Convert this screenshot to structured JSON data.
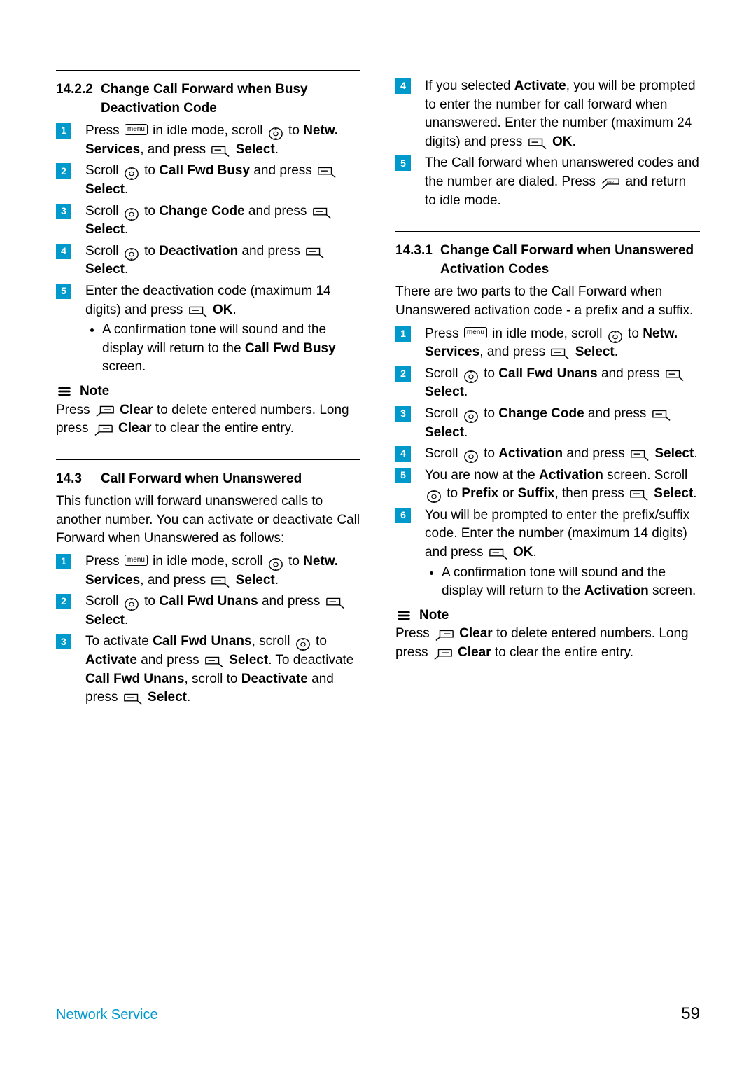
{
  "footer": {
    "section": "Network Service",
    "page": "59"
  },
  "icons": {
    "menu_label": "menu",
    "end_label": "END"
  },
  "left": {
    "sec1422": {
      "num": "14.2.2",
      "title": "Change Call Forward when Busy Deactivation Code",
      "steps": [
        {
          "pre": "Press ",
          "mid": " in idle mode, scroll ",
          "post": " to ",
          "b1": "Netw. Services",
          "mid2": ", and press ",
          "b2": "Select",
          "end": "."
        },
        {
          "pre": "Scroll ",
          "mid": " to ",
          "b1": "Call Fwd Busy",
          "mid2": " and press ",
          "b2": "Select",
          "end": "."
        },
        {
          "pre": "Scroll ",
          "mid": " to ",
          "b1": "Change Code",
          "mid2": " and press ",
          "b2": "Select",
          "end": "."
        },
        {
          "pre": "Scroll ",
          "mid": " to ",
          "b1": "Deactivation",
          "mid2": " and press ",
          "b2": "Select",
          "end": "."
        },
        {
          "plain1": "Enter the deactivation code (maximum 14 digits) and press ",
          "b1": "OK",
          "end": ".",
          "bullet": {
            "t1": "A confirmation tone will sound and the display will return to the ",
            "b": "Call Fwd Busy",
            "t2": " screen."
          }
        }
      ],
      "note_label": "Note",
      "note": {
        "t1": "Press ",
        "b1": "Clear",
        "t2": " to delete entered numbers. Long press ",
        "b2": "Clear",
        "t3": " to clear the entire entry."
      }
    },
    "sec143": {
      "num": "14.3",
      "title": "Call Forward when Unanswered",
      "intro": "This function will forward unanswered calls to another number. You can activate or deactivate Call Forward when Unanswered as follows:",
      "steps": [
        {
          "pre": "Press ",
          "mid": " in idle mode, scroll ",
          "post": " to ",
          "b1": "Netw. Services",
          "mid2": ", and press ",
          "b2": "Select",
          "end": "."
        },
        {
          "pre": "Scroll ",
          "mid": " to ",
          "b1": "Call Fwd Unans",
          "mid2": " and press ",
          "b2": "Select",
          "end": "."
        },
        {
          "s3": {
            "t1": "To activate ",
            "b1": "Call Fwd Unans",
            "t2": ", scroll ",
            "t3": " to ",
            "b2": "Activate",
            "t4": " and press ",
            "b3": "Select",
            "t5": ". To deactivate ",
            "b4": "Call Fwd Unans",
            "t6": ", scroll to ",
            "b5": "Deactivate",
            "t7": " and press ",
            "b6": "Select",
            "end": "."
          }
        }
      ]
    }
  },
  "right": {
    "cont": {
      "step4": {
        "t1": "If you selected ",
        "b1": "Activate",
        "t2": ", you will be prompted to enter the number for call forward when unanswered. Enter the number (maximum 24 digits) and press ",
        "b2": "OK",
        "end": "."
      },
      "step5": {
        "t1": "The Call forward when unanswered codes and the number are dialed. Press ",
        "t2": " and return to idle mode."
      }
    },
    "sec1431": {
      "num": "14.3.1",
      "title": "Change Call Forward when Unanswered Activation Codes",
      "intro": "There are two parts to the Call Forward when Unanswered activation code - a prefix and a suffix.",
      "steps": [
        {
          "pre": "Press ",
          "mid": " in idle mode, scroll ",
          "post": " to ",
          "b1": "Netw. Services",
          "mid2": ", and press ",
          "b2": "Select",
          "end": "."
        },
        {
          "pre": "Scroll ",
          "mid": " to ",
          "b1": "Call Fwd Unans",
          "mid2": " and press ",
          "b2": "Select",
          "end": "."
        },
        {
          "pre": "Scroll ",
          "mid": " to ",
          "b1": "Change Code",
          "mid2": " and press ",
          "b2": "Select",
          "end": "."
        },
        {
          "pre": "Scroll ",
          "mid": " to ",
          "b1": "Activation",
          "mid2": " and press ",
          "b2": "Select",
          "end": "."
        },
        {
          "s5": {
            "t1": "You are now at the ",
            "b1": "Activation",
            "t2": " screen. Scroll ",
            "t3": " to ",
            "b2": "Prefix",
            "t4": " or ",
            "b3": "Suffix",
            "t5": ", then press ",
            "b4": "Select",
            "end": "."
          }
        },
        {
          "s6": {
            "t1": "You will be prompted to enter the prefix/suffix code. Enter the number (maximum 14 digits) and press ",
            "b1": "OK",
            "end": ".",
            "bullet": {
              "t1": "A confirmation tone will sound and the display will return to the ",
              "b": "Activation",
              "t2": " screen."
            }
          }
        }
      ],
      "note_label": "Note",
      "note": {
        "t1": "Press ",
        "b1": "Clear",
        "t2": " to delete entered numbers. Long press ",
        "b2": "Clear",
        "t3": " to clear the entire entry."
      }
    }
  }
}
